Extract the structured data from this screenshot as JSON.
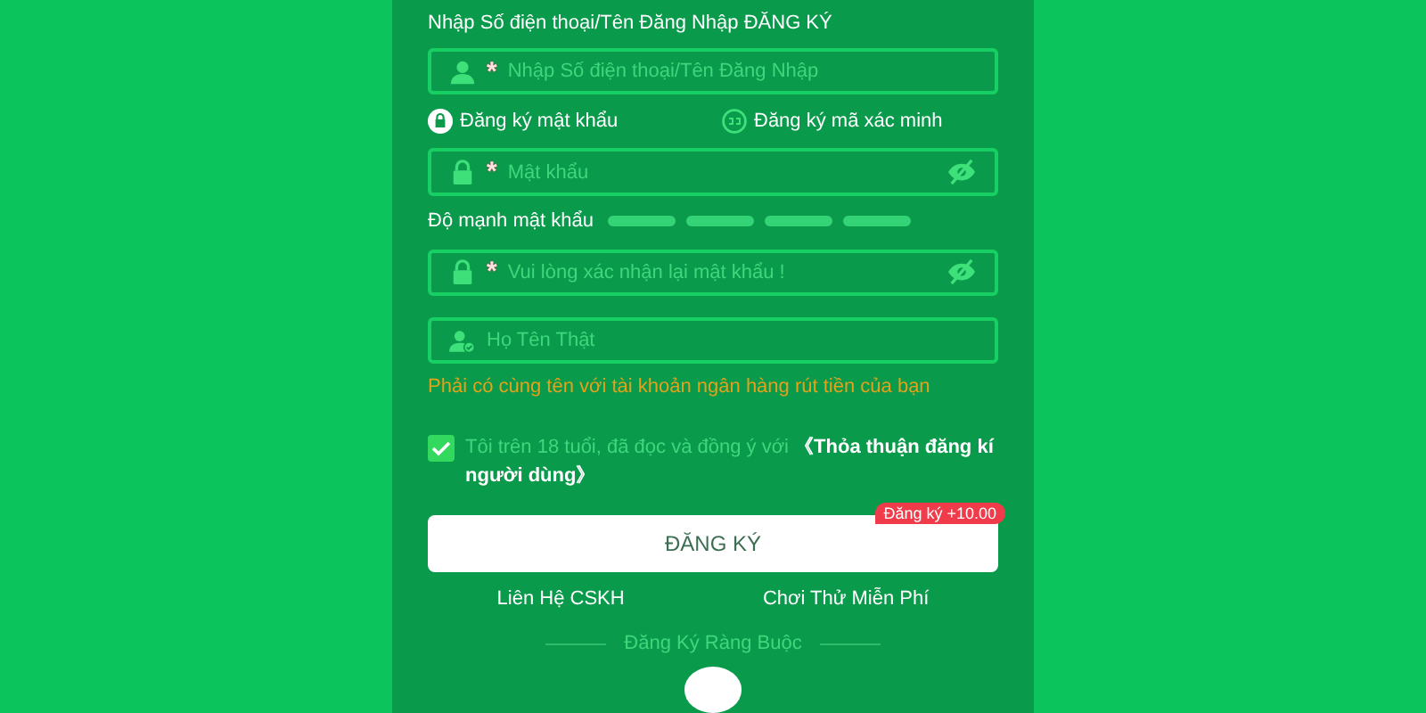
{
  "heading": "Nhập Số điện thoại/Tên Đăng Nhập ĐĂNG KÝ",
  "fields": [
    {
      "kind": "user",
      "mark": "*",
      "placeholder": "Nhập Số điện thoại/Tên Đăng Nhập",
      "eye": false
    }
  ],
  "tabs": [
    {
      "kind": "lock",
      "label": "Đăng ký mật khẩu",
      "selected": true
    },
    {
      "kind": "code",
      "label": "Đăng ký mã xác minh",
      "selected": false
    }
  ],
  "password_field": {
    "kind": "lock",
    "mark": "*",
    "placeholder": "Mật khẩu",
    "eye": true
  },
  "strength": {
    "label": "Độ mạnh mật khẩu"
  },
  "more_fields": [
    {
      "kind": "lock",
      "mark": "*",
      "placeholder": "Vui lòng xác nhận lại mật khẩu !",
      "eye": true
    },
    {
      "kind": "person-check",
      "placeholder": "Họ Tên Thật",
      "eye": false
    }
  ],
  "hint": "Phải có cùng tên với tài khoản ngân hàng rút tiền của bạn",
  "agreement": {
    "checked": true,
    "text": "Tôi trên 18 tuổi, đã đọc và đồng ý với",
    "link_lines": [
      "《Thỏa thuận đăng kí",
      "người dùng》"
    ]
  },
  "submit": {
    "label": "ĐĂNG KÝ",
    "badge": "Đăng ký +10.00"
  },
  "links": [
    "Liên Hệ CSKH",
    "Chơi Thử Miễn Phí"
  ],
  "divider": "Đăng Ký Ràng Buộc"
}
